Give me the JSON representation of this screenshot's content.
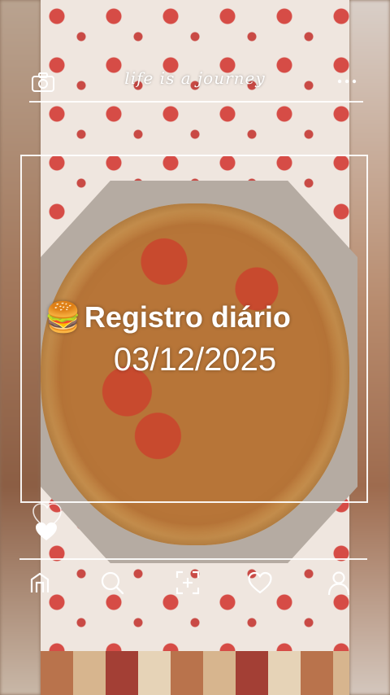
{
  "header": {
    "title": "life is a journey"
  },
  "entry": {
    "title_emoji": "🍔",
    "title": "Registro diário",
    "date": "03/12/2025"
  },
  "icons": {
    "top_left": "camera-icon",
    "top_right": "more-icon",
    "like_outline": "heart-outline-icon",
    "like_filled": "heart-filled-icon"
  },
  "navbar": {
    "items": [
      "home-icon",
      "search-icon",
      "add-icon",
      "heart-icon",
      "profile-icon"
    ]
  },
  "colors": {
    "overlay_text": "#ffffff",
    "tablecloth": "#efe6df",
    "accent_red": "#d64c46"
  }
}
